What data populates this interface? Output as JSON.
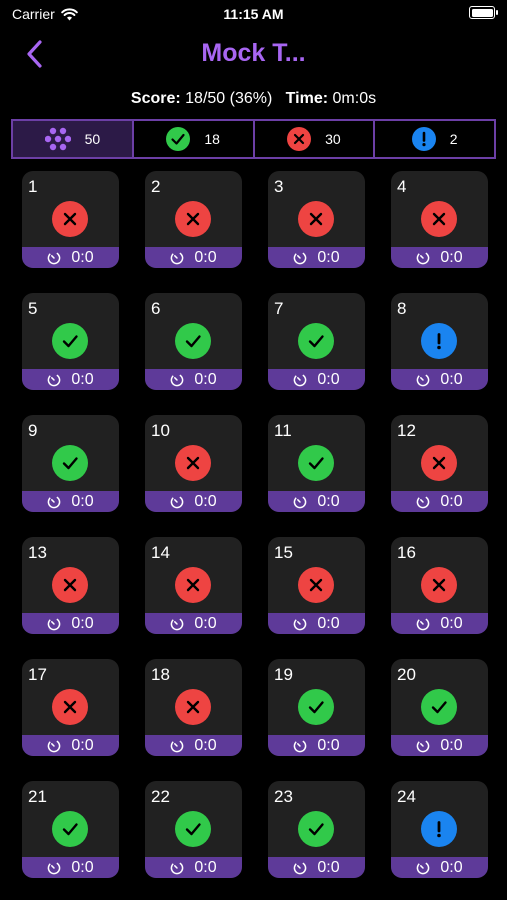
{
  "status": {
    "carrier": "Carrier",
    "time": "11:15 AM"
  },
  "nav": {
    "title": "Mock T..."
  },
  "summary": {
    "score_label": "Score:",
    "score_value": "18/50 (36%)",
    "time_label": "Time:",
    "time_value": "0m:0s"
  },
  "filters": [
    {
      "icon": "grid-dots-icon",
      "count": "50"
    },
    {
      "icon": "check-circle-icon",
      "count": "18"
    },
    {
      "icon": "x-circle-icon",
      "count": "30"
    },
    {
      "icon": "exclamation-circle-icon",
      "count": "2"
    }
  ],
  "colors": {
    "accent": "#a866f2",
    "strip": "#5e3a99",
    "wrong": "#ee4442",
    "correct": "#31c94a",
    "skipped": "#1a84f0",
    "card": "#212121"
  },
  "questions": [
    {
      "num": "1",
      "status": "wrong",
      "time": "0:0"
    },
    {
      "num": "2",
      "status": "wrong",
      "time": "0:0"
    },
    {
      "num": "3",
      "status": "wrong",
      "time": "0:0"
    },
    {
      "num": "4",
      "status": "wrong",
      "time": "0:0"
    },
    {
      "num": "5",
      "status": "correct",
      "time": "0:0"
    },
    {
      "num": "6",
      "status": "correct",
      "time": "0:0"
    },
    {
      "num": "7",
      "status": "correct",
      "time": "0:0"
    },
    {
      "num": "8",
      "status": "skipped",
      "time": "0:0"
    },
    {
      "num": "9",
      "status": "correct",
      "time": "0:0"
    },
    {
      "num": "10",
      "status": "wrong",
      "time": "0:0"
    },
    {
      "num": "11",
      "status": "correct",
      "time": "0:0"
    },
    {
      "num": "12",
      "status": "wrong",
      "time": "0:0"
    },
    {
      "num": "13",
      "status": "wrong",
      "time": "0:0"
    },
    {
      "num": "14",
      "status": "wrong",
      "time": "0:0"
    },
    {
      "num": "15",
      "status": "wrong",
      "time": "0:0"
    },
    {
      "num": "16",
      "status": "wrong",
      "time": "0:0"
    },
    {
      "num": "17",
      "status": "wrong",
      "time": "0:0"
    },
    {
      "num": "18",
      "status": "wrong",
      "time": "0:0"
    },
    {
      "num": "19",
      "status": "correct",
      "time": "0:0"
    },
    {
      "num": "20",
      "status": "correct",
      "time": "0:0"
    },
    {
      "num": "21",
      "status": "correct",
      "time": "0:0"
    },
    {
      "num": "22",
      "status": "correct",
      "time": "0:0"
    },
    {
      "num": "23",
      "status": "correct",
      "time": "0:0"
    },
    {
      "num": "24",
      "status": "skipped",
      "time": "0:0"
    }
  ]
}
